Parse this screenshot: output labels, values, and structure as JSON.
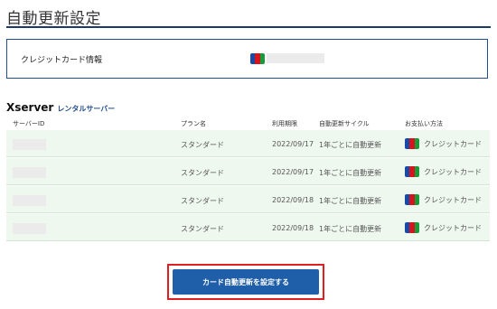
{
  "page": {
    "title": "自動更新設定"
  },
  "card": {
    "label": "クレジットカード情報",
    "brand_icon": "jcb-icon"
  },
  "section": {
    "brand": "Xserver",
    "brand_sub": "レンタルサーバー"
  },
  "table": {
    "headers": [
      "サーバーID",
      "プラン名",
      "利用期限",
      "自動更新サイクル",
      "お支払い方法"
    ],
    "rows": [
      {
        "plan": "スタンダード",
        "expiry": "2022/09/17",
        "cycle": "1年ごとに自動更新",
        "payment": "クレジットカード"
      },
      {
        "plan": "スタンダード",
        "expiry": "2022/09/17",
        "cycle": "1年ごとに自動更新",
        "payment": "クレジットカード"
      },
      {
        "plan": "スタンダード",
        "expiry": "2022/09/18",
        "cycle": "1年ごとに自動更新",
        "payment": "クレジットカード"
      },
      {
        "plan": "スタンダード",
        "expiry": "2022/09/18",
        "cycle": "1年ごとに自動更新",
        "payment": "クレジットカード"
      }
    ]
  },
  "actions": {
    "submit_label": "カード自動更新を設定する"
  },
  "colors": {
    "accent": "#1f5ea8",
    "row_bg": "#eff8ee",
    "highlight": "#e02020"
  }
}
